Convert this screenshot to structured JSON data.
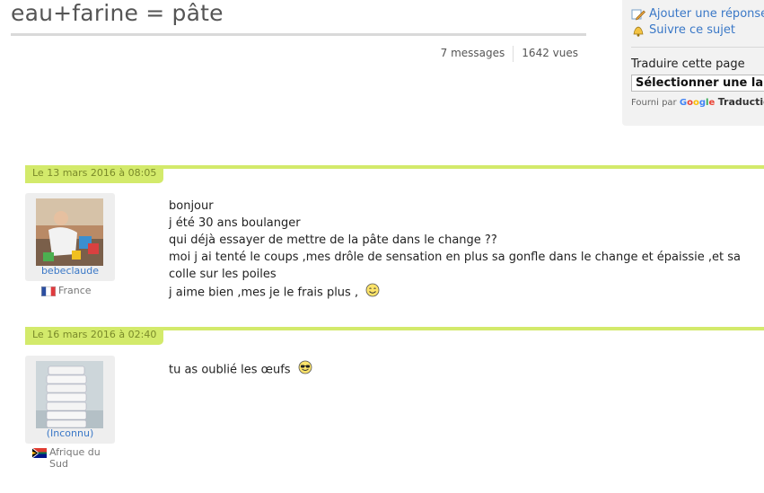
{
  "topic": {
    "title": "eau+farine = pâte",
    "messages": "7 messages",
    "views": "1642 vues"
  },
  "sidebar": {
    "reply_label": "Ajouter une réponse",
    "follow_label": "Suivre ce sujet",
    "translate_label": "Traduire cette page",
    "language_select_value": "Sélectionner une langue",
    "powered_prefix": "Fourni par",
    "google_letters": [
      "G",
      "o",
      "o",
      "g",
      "l",
      "e"
    ],
    "google_colors": [
      "#4285F4",
      "#EA4335",
      "#FBBC05",
      "#4285F4",
      "#34A853",
      "#EA4335"
    ],
    "translate_word": "Traduction"
  },
  "posts": [
    {
      "date": "Le 13 mars 2016 à 08:05",
      "author": "bebeclaude",
      "country": "France",
      "lines": [
        "bonjour",
        "j été 30 ans boulanger",
        "qui déjà essayer de mettre de la pâte dans le change ??",
        "moi j ai tenté le coups ,mes drôle de sensation en plus sa gonfle dans le change et épaissie ,et sa",
        "colle sur les poiles",
        "j aime bien ,mes je le frais plus ,"
      ],
      "smiley": "smile-emoticon-icon"
    },
    {
      "date": "Le 16 mars 2016 à 02:40",
      "author": "(Inconnu)",
      "country": "Afrique du Sud",
      "lines": [
        "tu as oublié les œufs"
      ],
      "smiley": "sunglasses-emoticon-icon"
    }
  ],
  "colors": {
    "accent_green": "#d3ea6b",
    "link_blue": "#3a78c7"
  }
}
